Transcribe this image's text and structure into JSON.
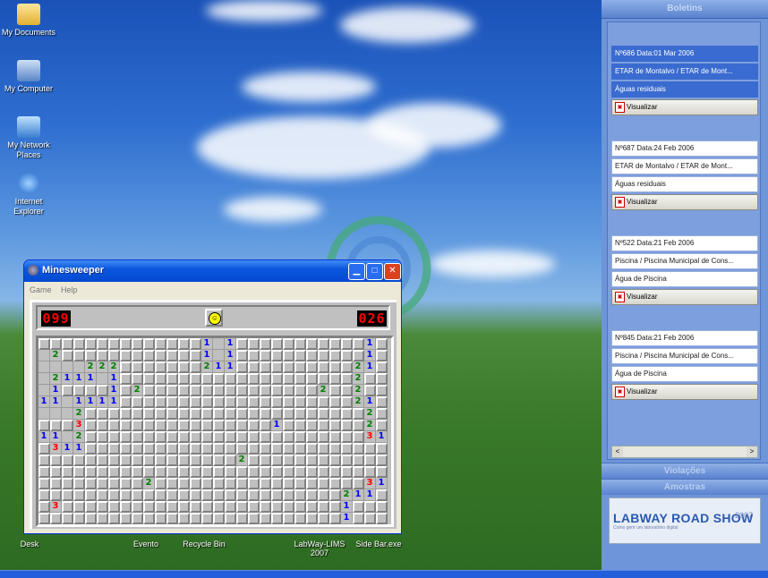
{
  "desktop": {
    "icons": [
      {
        "label": "My Documents",
        "icon": "folder-icon"
      },
      {
        "label": "My Computer",
        "icon": "computer-icon"
      },
      {
        "label": "My Network Places",
        "icon": "network-icon"
      },
      {
        "label": "Internet Explorer",
        "icon": "ie-icon"
      }
    ],
    "bottom_labels": [
      "Desk",
      "Evento",
      "Recycle Bin",
      "LabWay-LIMS 2007",
      "Side Bar.exe"
    ]
  },
  "sidebar": {
    "header": "Boletins",
    "boletins": [
      {
        "id_date": "Nº686  Data:01 Mar 2006",
        "location": "ETAR de Montalvo / ETAR de Mont...",
        "type": "Águas residuais",
        "action": "Visualizar",
        "selected": true
      },
      {
        "id_date": "Nº687  Data:24 Feb 2006",
        "location": "ETAR de Montalvo / ETAR de Mont...",
        "type": "Águas residuais",
        "action": "Visualizar",
        "selected": false
      },
      {
        "id_date": "Nº522  Data:21 Feb 2006",
        "location": "Piscina / Piscina Municipal de Cons...",
        "type": "Água de Piscina",
        "action": "Visualizar",
        "selected": false
      },
      {
        "id_date": "Nº845  Data:21 Feb 2006",
        "location": "Piscina / Piscina Municipal de Cons...",
        "type": "Água de Piscina",
        "action": "Visualizar",
        "selected": false
      }
    ],
    "violacoes": "Violações",
    "amostras": "Amostras",
    "banner_title": "LABWAY ROAD SHOW",
    "banner_year": "2007",
    "banner_sub": "Como gerir um laboratório digital",
    "scroll_left": "<",
    "scroll_right": ">"
  },
  "minesweeper": {
    "title": "Minesweeper",
    "menu": [
      "Game",
      "Help"
    ],
    "mines_left": "099",
    "timer": "026",
    "face": "☺",
    "opened": [
      [
        0,
        14,
        1
      ],
      [
        0,
        15,
        0
      ],
      [
        0,
        16,
        1
      ],
      [
        0,
        28,
        1
      ],
      [
        1,
        0,
        0
      ],
      [
        1,
        1,
        2
      ],
      [
        1,
        14,
        1
      ],
      [
        1,
        15,
        0
      ],
      [
        1,
        16,
        1
      ],
      [
        1,
        28,
        1
      ],
      [
        2,
        0,
        0
      ],
      [
        2,
        1,
        0
      ],
      [
        2,
        2,
        0
      ],
      [
        2,
        3,
        0
      ],
      [
        2,
        4,
        2
      ],
      [
        2,
        5,
        2
      ],
      [
        2,
        6,
        2
      ],
      [
        2,
        14,
        2
      ],
      [
        2,
        15,
        1
      ],
      [
        2,
        16,
        1
      ],
      [
        2,
        27,
        2
      ],
      [
        2,
        28,
        1
      ],
      [
        3,
        0,
        0
      ],
      [
        3,
        1,
        2
      ],
      [
        3,
        2,
        1
      ],
      [
        3,
        3,
        1
      ],
      [
        3,
        4,
        1
      ],
      [
        3,
        5,
        0
      ],
      [
        3,
        6,
        1
      ],
      [
        3,
        27,
        2
      ],
      [
        4,
        0,
        0
      ],
      [
        4,
        1,
        1
      ],
      [
        4,
        6,
        1
      ],
      [
        4,
        8,
        2
      ],
      [
        4,
        24,
        2
      ],
      [
        4,
        27,
        2
      ],
      [
        5,
        0,
        1
      ],
      [
        5,
        1,
        1
      ],
      [
        5,
        2,
        0
      ],
      [
        5,
        3,
        1
      ],
      [
        5,
        4,
        1
      ],
      [
        5,
        5,
        1
      ],
      [
        5,
        6,
        1
      ],
      [
        5,
        27,
        2
      ],
      [
        5,
        28,
        1
      ],
      [
        6,
        0,
        0
      ],
      [
        6,
        1,
        0
      ],
      [
        6,
        2,
        0
      ],
      [
        6,
        3,
        2
      ],
      [
        6,
        28,
        2
      ],
      [
        7,
        3,
        3
      ],
      [
        7,
        20,
        1
      ],
      [
        7,
        28,
        2
      ],
      [
        8,
        0,
        1
      ],
      [
        8,
        1,
        1
      ],
      [
        8,
        2,
        0
      ],
      [
        8,
        3,
        2
      ],
      [
        8,
        28,
        3
      ],
      [
        8,
        29,
        1
      ],
      [
        9,
        1,
        3
      ],
      [
        9,
        2,
        1
      ],
      [
        9,
        3,
        1
      ],
      [
        10,
        17,
        2
      ],
      [
        12,
        9,
        2
      ],
      [
        12,
        28,
        3
      ],
      [
        12,
        29,
        1
      ],
      [
        13,
        26,
        2
      ],
      [
        13,
        27,
        1
      ],
      [
        13,
        28,
        1
      ],
      [
        14,
        1,
        3
      ],
      [
        14,
        26,
        1
      ],
      [
        15,
        26,
        1
      ]
    ]
  }
}
